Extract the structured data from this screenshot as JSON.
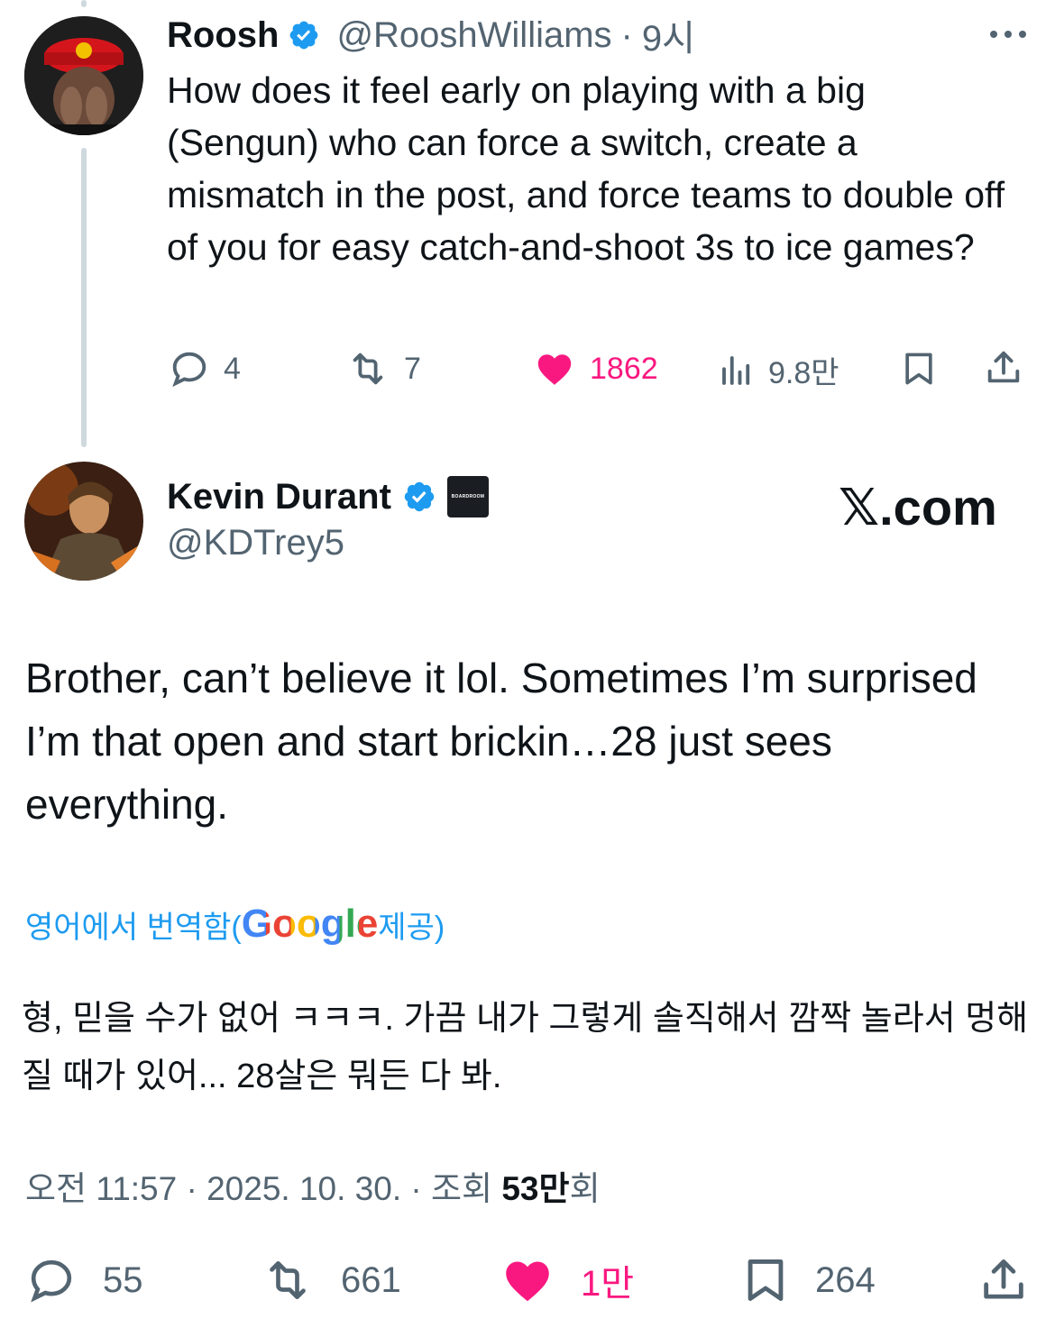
{
  "colors": {
    "accent_blue": "#1d9bf0",
    "like_pink": "#f91880",
    "text_primary": "#0f1419",
    "text_secondary": "#536471",
    "thread_line": "#cfd9de"
  },
  "parent_tweet": {
    "author_name": "Roosh",
    "verified_icon": "verified-badge-icon",
    "handle": "@RooshWilliams",
    "separator": "·",
    "time": "9시",
    "more_icon": "more-dots-icon",
    "text": "How does it feel early on playing with a big (Sengun) who can force a switch, create a mismatch in the post, and force teams to double off of you for easy catch-and-shoot 3s to ice games?",
    "actions": {
      "replies": "4",
      "retweets": "7",
      "likes": "1862",
      "views": "9.8만"
    }
  },
  "main_tweet": {
    "author_name": "Kevin Durant",
    "verified_icon": "verified-badge-icon",
    "affiliate_badge_text": "BOARDROOM",
    "handle": "@KDTrey5",
    "watermark": "𝕏.com",
    "text": "Brother, can’t believe it lol. Sometimes I’m surprised I’m that open and start brickin…28 just sees everything.",
    "translation_label_prefix": "영어에서 번역함(",
    "translation_provider": "Google",
    "translation_label_suffix": " 제공)",
    "translated_text": "형, 믿을 수가 없어 ㅋㅋㅋ. 가끔 내가 그렇게 솔직해서 깜짝 놀라서 멍해질 때가 있어... 28살은 뭐든 다 봐.",
    "meta_time": "오전 11:57 · 2025. 10. 30. · 조회 ",
    "meta_views": "53만",
    "meta_views_suffix": "회",
    "actions": {
      "replies": "55",
      "retweets": "661",
      "likes": "1만",
      "bookmarks": "264"
    }
  }
}
